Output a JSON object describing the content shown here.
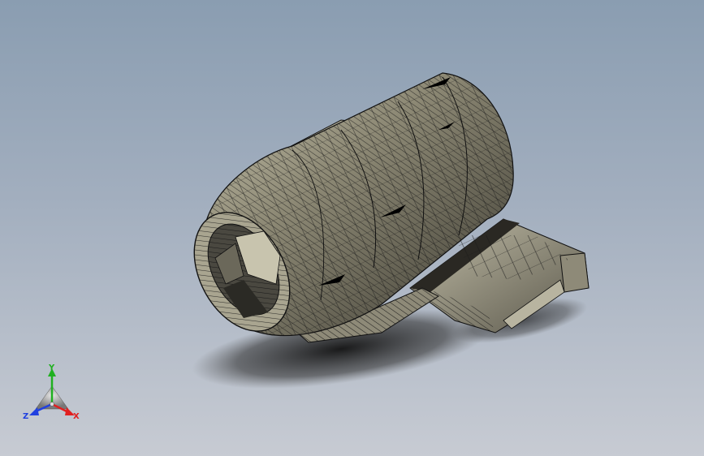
{
  "viewport": {
    "background_top": "#8a9db1",
    "background_bottom": "#c7cbd3"
  },
  "model": {
    "shell_color": "#6f6b5c",
    "shell_highlight": "#b9b5a0",
    "edge_color": "#101010",
    "mount_color": "#9a9685"
  },
  "triad": {
    "x_label": "X",
    "y_label": "Y",
    "z_label": "Z",
    "x_color": "#e02020",
    "y_color": "#20b020",
    "z_color": "#2040e0"
  }
}
